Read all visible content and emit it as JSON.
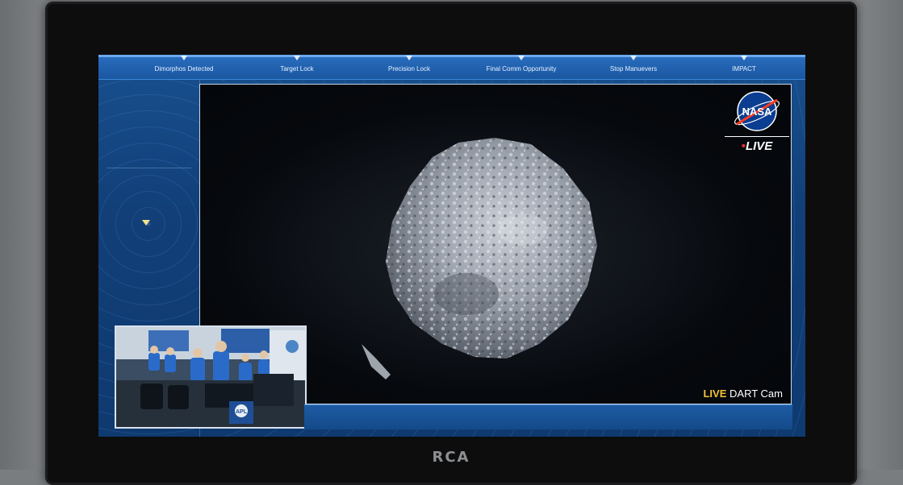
{
  "timeline": {
    "milestones": [
      {
        "label": "Dimorphos Detected"
      },
      {
        "label": "Target Lock"
      },
      {
        "label": "Precision Lock"
      },
      {
        "label": "Final Comm Opportunity"
      },
      {
        "label": "Stop Manuevers"
      },
      {
        "label": "IMPACT"
      }
    ]
  },
  "video": {
    "logo_text": "NASA",
    "live_badge": "LIVE",
    "live_dot": "•",
    "cam_live": "LIVE",
    "cam_name": "DART Cam"
  },
  "pip": {
    "logo_text": "APL"
  },
  "monitor": {
    "brand": "RCA"
  },
  "colors": {
    "screen_blue": "#123e73",
    "timeline_blue": "#1a56a0",
    "live_yellow": "#f2c23a",
    "live_dot_red": "#e03030"
  }
}
